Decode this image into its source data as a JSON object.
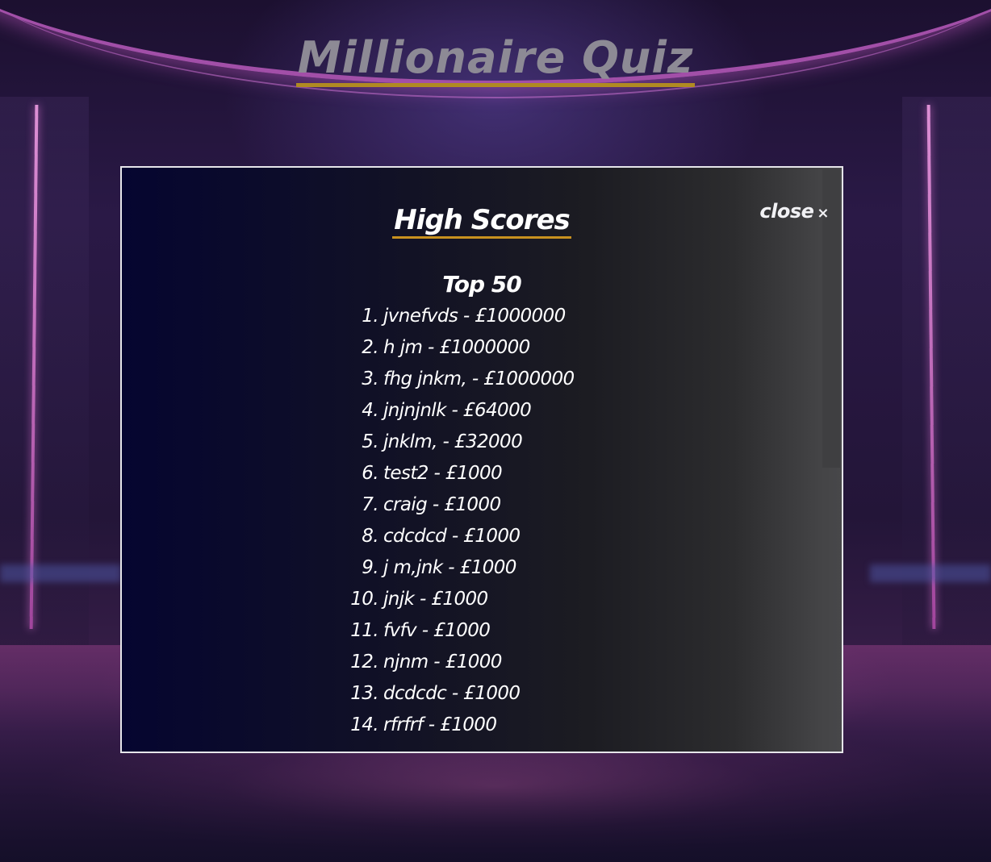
{
  "app": {
    "title": "Millionaire Quiz"
  },
  "modal": {
    "title": "High Scores",
    "close_label": "close",
    "close_icon": "×",
    "list_heading": "Top 50",
    "scores": [
      {
        "rank": "1.",
        "entry": "jvnefvds - £1000000"
      },
      {
        "rank": "2.",
        "entry": "h jm - £1000000"
      },
      {
        "rank": "3.",
        "entry": "fhg jnkm, - £1000000"
      },
      {
        "rank": "4.",
        "entry": "jnjnjnlk - £64000"
      },
      {
        "rank": "5.",
        "entry": "jnklm, - £32000"
      },
      {
        "rank": "6.",
        "entry": "test2 - £1000"
      },
      {
        "rank": "7.",
        "entry": "craig - £1000"
      },
      {
        "rank": "8.",
        "entry": "cdcdcd - £1000"
      },
      {
        "rank": "9.",
        "entry": "j m,jnk - £1000"
      },
      {
        "rank": "10.",
        "entry": "jnjk - £1000"
      },
      {
        "rank": "11.",
        "entry": "fvfv - £1000"
      },
      {
        "rank": "12.",
        "entry": "njnm - £1000"
      },
      {
        "rank": "13.",
        "entry": "dcdcdc - £1000"
      },
      {
        "rank": "14.",
        "entry": "rfrfrf - £1000"
      }
    ]
  },
  "colors": {
    "title_underline": "#b08a22",
    "heading_underline": "#c8911f",
    "modal_border": "#e6e6ea"
  }
}
